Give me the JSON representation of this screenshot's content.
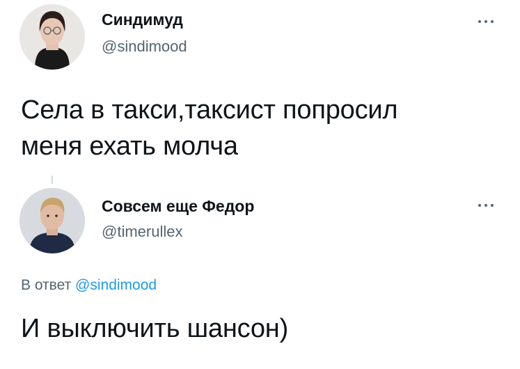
{
  "colors": {
    "text": "#0f1419",
    "secondary": "#536471",
    "link": "#1d9bf0",
    "background": "#ffffff"
  },
  "original_tweet": {
    "display_name": "Синдимуд",
    "handle": "@sindimood",
    "text_line_1": "Села в такси,таксист попросил",
    "text_line_2": "меня ехать молча",
    "avatar_icon": "avatar-woman-glasses",
    "more_icon": "more-dots-icon"
  },
  "reply_tweet": {
    "display_name": "Совсем еще Федор",
    "handle": "@timerullex",
    "reply_prefix": "В ответ",
    "reply_mention": "@sindimood",
    "text": "И выключить шансон)",
    "avatar_icon": "avatar-man",
    "more_icon": "more-dots-icon"
  }
}
